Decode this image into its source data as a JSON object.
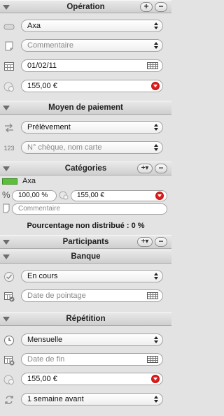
{
  "operation": {
    "title": "Opération",
    "payee": "Axa",
    "comment_placeholder": "Commentaire",
    "date": "01/02/11",
    "amount": "155,00 €"
  },
  "payment": {
    "title": "Moyen de paiement",
    "method": "Prélèvement",
    "check_placeholder": "N° chèque, nom carte"
  },
  "categories": {
    "title": "Catégories",
    "item_name": "Axa",
    "item_color": "#5cbf3a",
    "percent": "100,00 %",
    "amount": "155,00 €",
    "comment_placeholder": "Commentaire",
    "undistributed": "Pourcentage non distribué : 0 %"
  },
  "participants": {
    "title": "Participants"
  },
  "bank": {
    "title": "Banque",
    "status": "En cours",
    "checkdate_placeholder": "Date de pointage"
  },
  "repeat": {
    "title": "Répétition",
    "frequency": "Mensuelle",
    "enddate_placeholder": "Date de fin",
    "amount": "155,00 €",
    "reminder": "1 semaine avant"
  },
  "buttons": {
    "plus": "+",
    "minus": "−",
    "plus_menu": "+▾"
  }
}
